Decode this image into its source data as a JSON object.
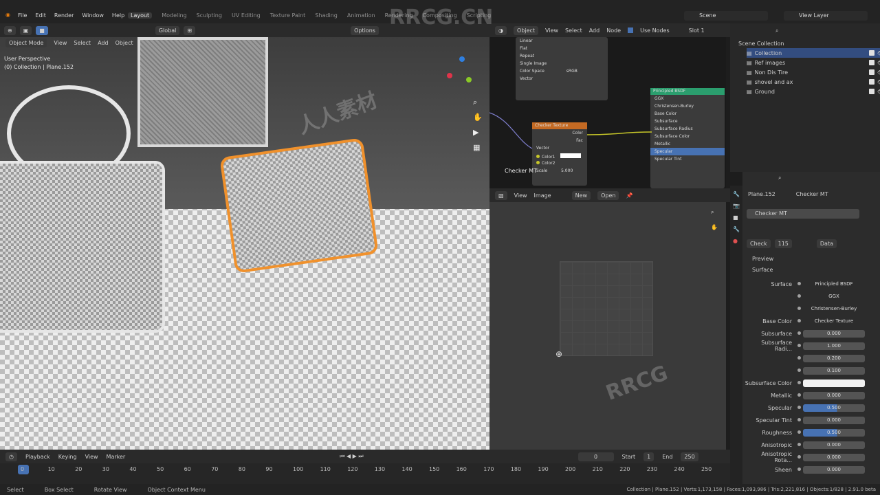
{
  "menu": [
    "File",
    "Edit",
    "Render",
    "Window",
    "Help"
  ],
  "workspaces": [
    "Layout",
    "Modeling",
    "Sculpting",
    "UV Editing",
    "Texture Paint",
    "Shading",
    "Animation",
    "Rendering",
    "Compositing",
    "Scripting"
  ],
  "active_workspace": "Layout",
  "scene": "Scene",
  "view_layer": "View Layer",
  "viewport": {
    "transform": "Global",
    "options": "Options",
    "mode": "Object Mode",
    "menu": [
      "View",
      "Select",
      "Add",
      "Object"
    ],
    "info_line1": "User Perspective",
    "info_line2": "(0) Collection | Plane.152"
  },
  "node_editor": {
    "object_label": "Object",
    "menu": [
      "View",
      "Select",
      "Add",
      "Node"
    ],
    "use_nodes": "Use Nodes",
    "slot": "Slot 1",
    "image_node_rows": [
      "Linear",
      "Flat",
      "Repeat",
      "Single Image"
    ],
    "color_space_label": "Color Space",
    "color_space_value": "sRGB",
    "vector": "Vector",
    "checker_title": "Checker Texture",
    "checker_outputs": [
      "Color",
      "Fac"
    ],
    "checker_inputs": [
      "Vector",
      "Color1",
      "Color2",
      "Scale"
    ],
    "checker_scale": "5.000",
    "checker_float_label": "Checker MT",
    "bsdf_title": "Principled BSDF",
    "bsdf_rows": [
      "GGX",
      "Christensen-Burley",
      "Base Color",
      "Subsurface",
      "Subsurface Radius",
      "Subsurface Color",
      "Metallic",
      "Specular",
      "Specular Tint"
    ]
  },
  "image_editor": {
    "menu": [
      "View",
      "Image"
    ],
    "new": "New",
    "open": "Open"
  },
  "outliner": {
    "title": "Scene Collection",
    "items": [
      "Collection",
      "Ref images",
      "Non Dis Tire",
      "shovel and ax",
      "Ground"
    ]
  },
  "properties": {
    "object": "Plane.152",
    "material": "Checker MT",
    "material_slot": "Checker MT",
    "browse_name": "Check",
    "users": "115",
    "link": "Data",
    "preview": "Preview",
    "surface": "Surface",
    "rows": [
      {
        "label": "Surface",
        "value": "Principled BSDF",
        "kind": "link"
      },
      {
        "label": "",
        "value": "GGX",
        "kind": "menu"
      },
      {
        "label": "",
        "value": "Christensen-Burley",
        "kind": "menu"
      },
      {
        "label": "Base Color",
        "value": "Checker Texture",
        "kind": "link"
      },
      {
        "label": "Subsurface",
        "value": "0.000",
        "kind": "num"
      },
      {
        "label": "Subsurface Radi...",
        "value": "1.000",
        "kind": "num"
      },
      {
        "label": "",
        "value": "0.200",
        "kind": "num"
      },
      {
        "label": "",
        "value": "0.100",
        "kind": "num"
      },
      {
        "label": "Subsurface Color",
        "value": "",
        "kind": "white"
      },
      {
        "label": "Metallic",
        "value": "0.000",
        "kind": "num"
      },
      {
        "label": "Specular",
        "value": "0.500",
        "kind": "bar"
      },
      {
        "label": "Specular Tint",
        "value": "0.000",
        "kind": "num"
      },
      {
        "label": "Roughness",
        "value": "0.500",
        "kind": "bar"
      },
      {
        "label": "Anisotropic",
        "value": "0.000",
        "kind": "num"
      },
      {
        "label": "Anisotropic Rota...",
        "value": "0.000",
        "kind": "num"
      },
      {
        "label": "Sheen",
        "value": "0.000",
        "kind": "num"
      }
    ]
  },
  "timeline": {
    "menu": [
      "Playback",
      "Keying",
      "View",
      "Marker"
    ],
    "current_frame": "0",
    "start_label": "Start",
    "start": "1",
    "end_label": "End",
    "end": "250",
    "ticks": [
      "0",
      "10",
      "20",
      "30",
      "40",
      "50",
      "60",
      "70",
      "80",
      "90",
      "100",
      "110",
      "120",
      "130",
      "140",
      "150",
      "160",
      "170",
      "180",
      "190",
      "200",
      "210",
      "220",
      "230",
      "240",
      "250"
    ]
  },
  "status": {
    "select": "Select",
    "box_select": "Box Select",
    "rotate": "Rotate View",
    "context": "Object Context Menu",
    "stats": "Collection | Plane.152 | Verts:1,173,158 | Faces:1,093,986 | Tris:2,221,816 | Objects:1/828 | 2.91.0 beta"
  },
  "watermarks": [
    "RRCG.CN",
    "人人素材",
    "RRCG"
  ],
  "colors": {
    "accent": "#4772b3",
    "selection": "#f0912c",
    "node_green": "#2b9e6e",
    "node_orange": "#c46a23"
  }
}
